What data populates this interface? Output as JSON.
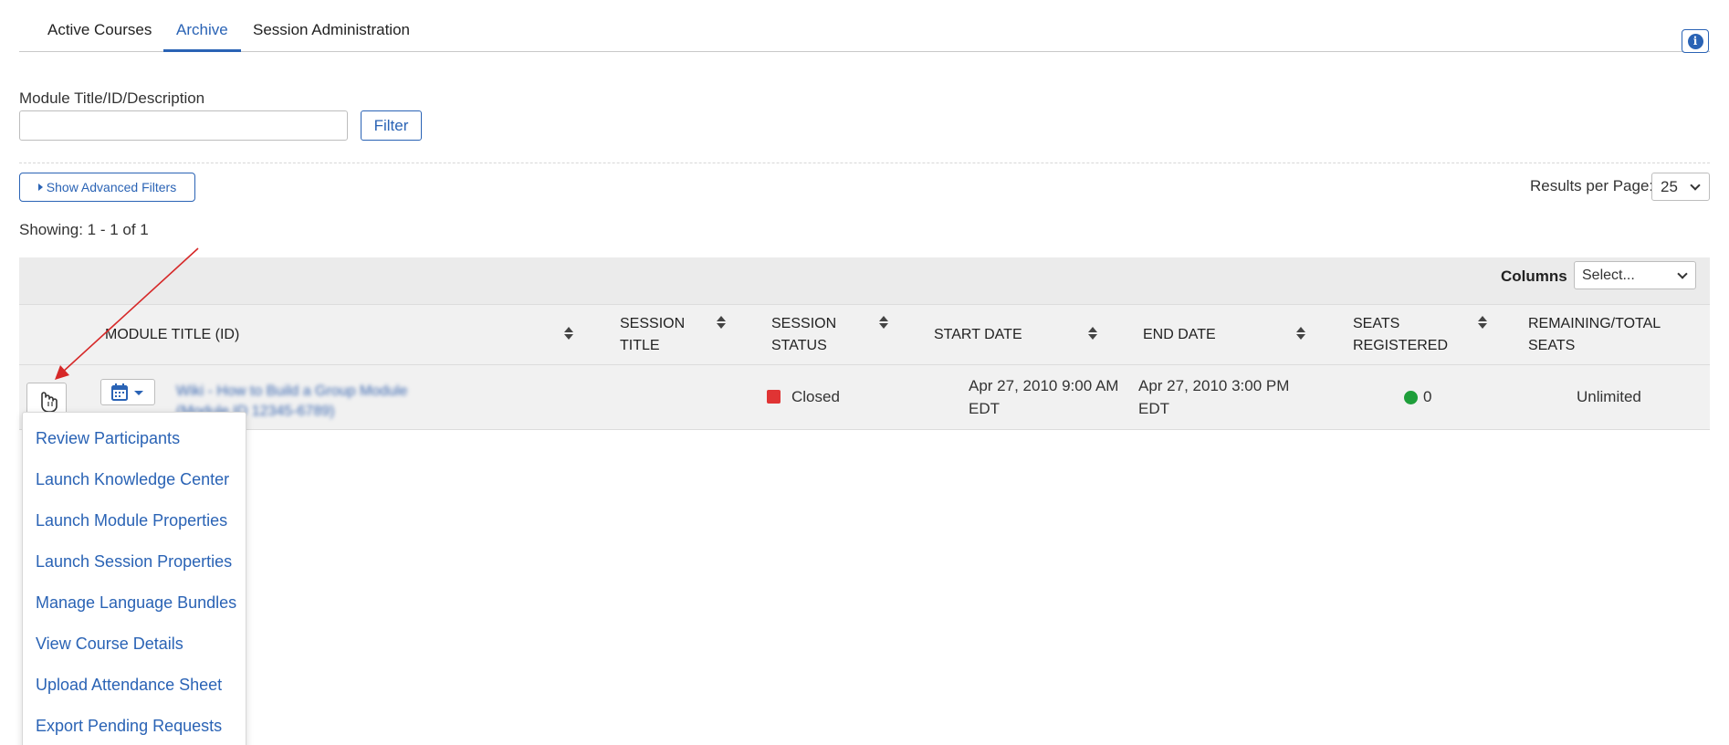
{
  "tabs": [
    {
      "label": "Active Courses",
      "active": false
    },
    {
      "label": "Archive",
      "active": true
    },
    {
      "label": "Session Administration",
      "active": false
    }
  ],
  "filter": {
    "label": "Module Title/ID/Description",
    "input_value": "",
    "button_label": "Filter"
  },
  "advanced_filters_label": "Show Advanced Filters",
  "results_per_page": {
    "label": "Results per Page:",
    "value": "25"
  },
  "showing_text": "Showing: 1 - 1 of 1",
  "columns": {
    "label": "Columns",
    "select_value": "Select..."
  },
  "table": {
    "headers": {
      "module_title": "MODULE TITLE (ID)",
      "session_title_1": "SESSION",
      "session_title_2": "TITLE",
      "session_status_1": "SESSION",
      "session_status_2": "STATUS",
      "start_date": "START DATE",
      "end_date": "END DATE",
      "seats_registered_1": "SEATS",
      "seats_registered_2": "REGISTERED",
      "remaining_total_1": "REMAINING/TOTAL",
      "remaining_total_2": "SEATS"
    },
    "row": {
      "module_title_line1": "Wiki - How to Build a Group Module",
      "module_title_line2": "(Module ID 12345-6789)",
      "session_status": "Closed",
      "start_date_line1": "Apr 27, 2010 9:00 AM",
      "start_date_line2": "EDT",
      "end_date_line1": "Apr 27, 2010 3:00 PM",
      "end_date_line2": "EDT",
      "seats_registered": "0",
      "remaining_total": "Unlimited"
    }
  },
  "menu": {
    "items": [
      "Review Participants",
      "Launch Knowledge Center",
      "Launch Module Properties",
      "Launch Session Properties",
      "Manage Language Bundles",
      "View Course Details",
      "Upload Attendance Sheet",
      "Export Pending Requests"
    ]
  },
  "colors": {
    "accent": "#2a63b5",
    "status_closed": "#e03434",
    "seats_dot": "#1e9e3a",
    "annotation_arrow": "#d62828"
  }
}
